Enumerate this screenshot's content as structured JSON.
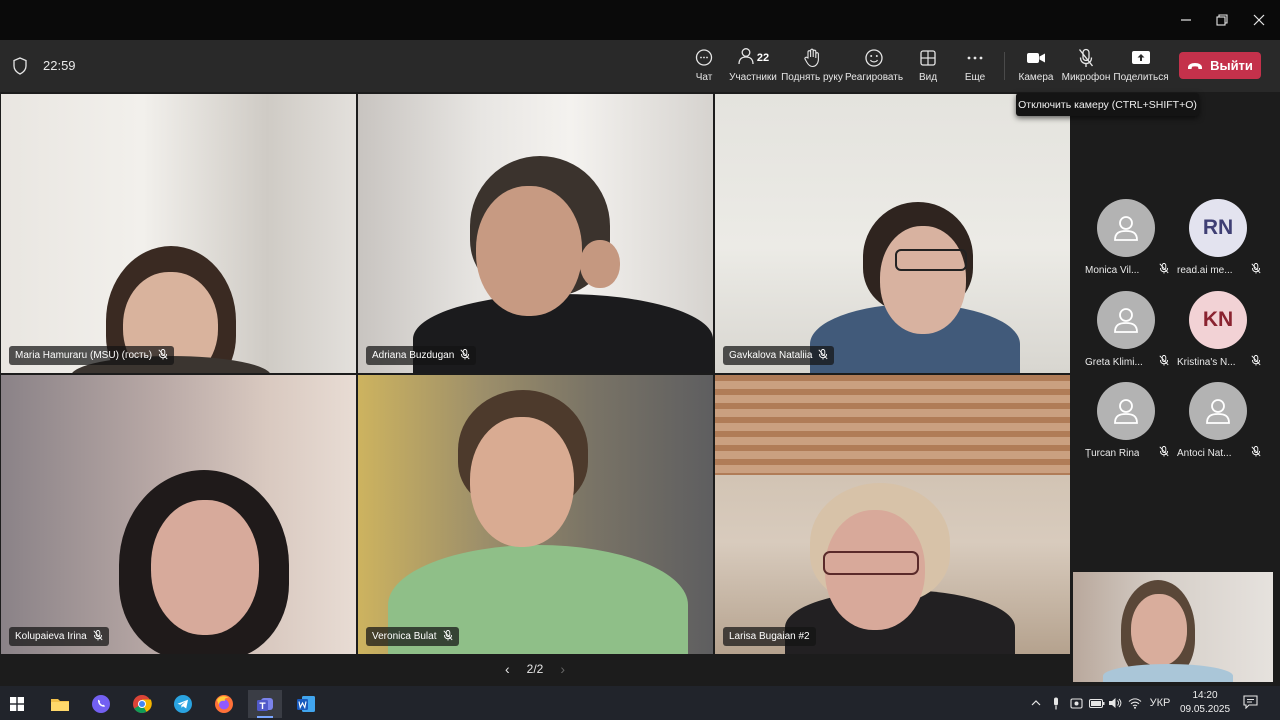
{
  "toolbar": {
    "timer": "22:59",
    "participants_count": "22",
    "buttons": {
      "chat": "Чат",
      "participants": "Участники",
      "raise_hand": "Поднять руку",
      "react": "Реагировать",
      "view": "Вид",
      "more": "Еще",
      "camera": "Камера",
      "mic": "Микрофон",
      "share": "Поделиться"
    },
    "leave_label": "Выйти",
    "leave_color": "#c4314b"
  },
  "tooltip": "Отключить камеру (CTRL+SHIFT+O)",
  "tiles": [
    {
      "name": "Maria Hamuraru (MSU) (гость)"
    },
    {
      "name": "Adriana Buzdugan"
    },
    {
      "name": "Gavkalova Nataliia"
    },
    {
      "name": "Kolupaieva Irina"
    },
    {
      "name": "Veronica Bulat"
    },
    {
      "name": "Larisa Bugaian #2"
    }
  ],
  "roster": [
    {
      "name": "Monica Vil...",
      "initials": ""
    },
    {
      "name": "read.ai me...",
      "initials": "RN",
      "avatar_bg": "#e3e3ef",
      "text_color": "#3f3f74"
    },
    {
      "name": "Greta Klimi...",
      "initials": ""
    },
    {
      "name": "Kristina's N...",
      "initials": "KN",
      "avatar_bg": "#f2d2d5",
      "text_color": "#8a2330"
    },
    {
      "name": "Țurcan Rina",
      "initials": ""
    },
    {
      "name": "Antoci Nat...",
      "initials": ""
    }
  ],
  "pager": {
    "page": "2/2"
  },
  "taskbar": {
    "language": "УКР",
    "time": "14:20",
    "date": "09.05.2025"
  }
}
